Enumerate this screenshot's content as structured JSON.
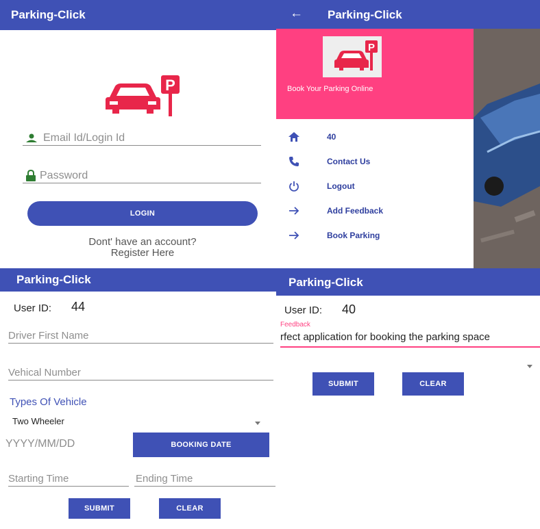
{
  "login": {
    "app_title": "Parking-Click",
    "email_placeholder": "Email Id/Login Id",
    "password_placeholder": "Password",
    "login_button": "LOGIN",
    "no_account": "Dont' have an account?",
    "register": "Register Here"
  },
  "drawer": {
    "back_icon": "←",
    "app_title": "Parking-Click",
    "header_text": "Book Your Parking Online",
    "items": [
      {
        "icon": "home-icon",
        "label": "40"
      },
      {
        "icon": "phone-icon",
        "label": "Contact Us"
      },
      {
        "icon": "power-icon",
        "label": "Logout"
      },
      {
        "icon": "arrow-right-icon",
        "label": "Add Feedback"
      },
      {
        "icon": "arrow-right-icon",
        "label": "Book Parking"
      }
    ]
  },
  "booking": {
    "app_title": "Parking-Click",
    "user_id_label": "User ID:",
    "user_id_value": "44",
    "driver_first_name_placeholder": "Driver First Name",
    "vehicle_number_placeholder": "Vehical Number",
    "types_of_vehicle_label": "Types Of Vehicle",
    "vehicle_type_selected": "Two Wheeler",
    "date_placeholder": "YYYY/MM/DD",
    "booking_date_button": "BOOKING DATE",
    "starting_time_placeholder": "Starting Time",
    "ending_time_placeholder": "Ending Time",
    "submit_button": "SUBMIT",
    "clear_button": "CLEAR"
  },
  "feedback": {
    "app_title": "Parking-Click",
    "user_id_label": "User ID:",
    "user_id_value": "40",
    "feedback_label": "Feedback",
    "feedback_value": "rfect application for booking the parking space",
    "submit_button": "SUBMIT",
    "clear_button": "CLEAR"
  },
  "colors": {
    "primary": "#3f51b5",
    "accent_pink": "#ff4081",
    "logo_red": "#e8264a"
  }
}
